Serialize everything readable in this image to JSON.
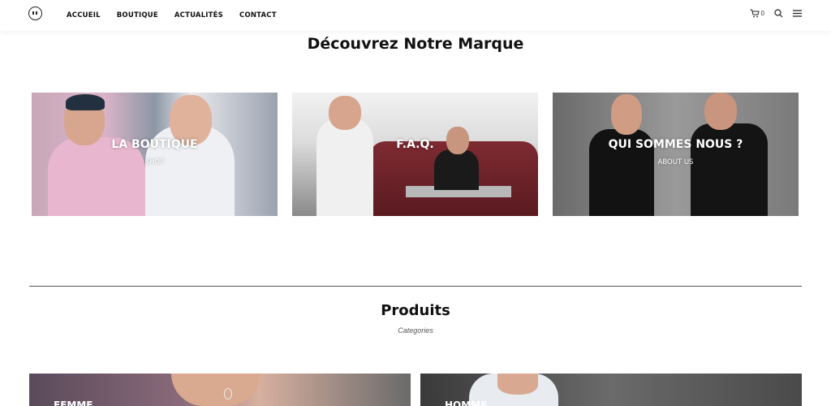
{
  "header": {
    "logo_icon": "smiley-logo-icon",
    "nav": [
      "ACCUEIL",
      "BOUTIQUE",
      "ACTUALITÉS",
      "CONTACT"
    ],
    "cart_count": "0"
  },
  "discover": {
    "title": "Découvrez Notre Marque",
    "tiles": [
      {
        "title": "LA BOUTIQUE",
        "subtitle": "SHOP"
      },
      {
        "title": "F.A.Q.",
        "subtitle": ""
      },
      {
        "title": "QUI SOMMES NOUS ?",
        "subtitle": "ABOUT US"
      }
    ]
  },
  "products": {
    "title": "Produits",
    "subtitle": "Categories",
    "categories": [
      {
        "label": "FEMME"
      },
      {
        "label": "HOMME"
      }
    ]
  },
  "colors": {
    "accent": "#111111",
    "divider": "#555555"
  }
}
